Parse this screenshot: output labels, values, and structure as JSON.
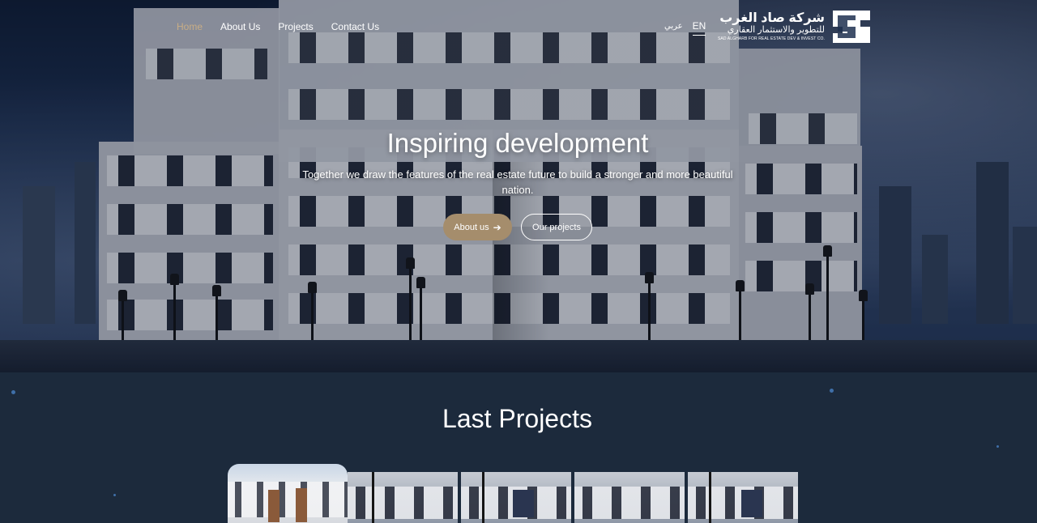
{
  "nav": {
    "items": [
      {
        "label": "Home",
        "active": true
      },
      {
        "label": "About Us",
        "active": false
      },
      {
        "label": "Projects",
        "active": false
      },
      {
        "label": "Contact Us",
        "active": false
      }
    ]
  },
  "lang": {
    "arabic": "عربي",
    "english": "EN",
    "active": "EN"
  },
  "logo": {
    "arabic_line1": "شركة صاد الغرب",
    "arabic_line2": "للتطوير والاستثمار العقاري",
    "english": "SAD ALGHARB FOR REAL ESTATE DEV & INVEST CO."
  },
  "hero": {
    "title": "Inspiring development",
    "subtitle": "Together we draw the features of the real estate future to build a stronger and more beautiful nation.",
    "primary_button": "About us",
    "secondary_button": "Our projects"
  },
  "projects": {
    "title": "Last Projects",
    "card_count": 5
  },
  "colors": {
    "accent": "#c8ad85",
    "button": "#a58d6c",
    "section_bg": "#1c2a3c"
  },
  "icons": [
    "arrow-right-icon",
    "company-logo-icon"
  ]
}
